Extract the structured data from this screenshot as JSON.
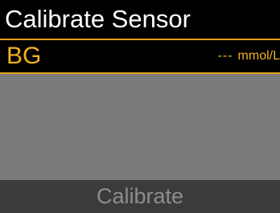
{
  "header": {
    "title": "Calibrate Sensor"
  },
  "bg_field": {
    "label": "BG",
    "value": "---",
    "unit": "mmol/L"
  },
  "footer": {
    "calibrate_label": "Calibrate"
  },
  "colors": {
    "accent": "#e3a21a",
    "background": "#000000",
    "panel": "#7a7a7a",
    "footer": "#3b3b3b",
    "disabled_text": "#8d8d8d"
  }
}
